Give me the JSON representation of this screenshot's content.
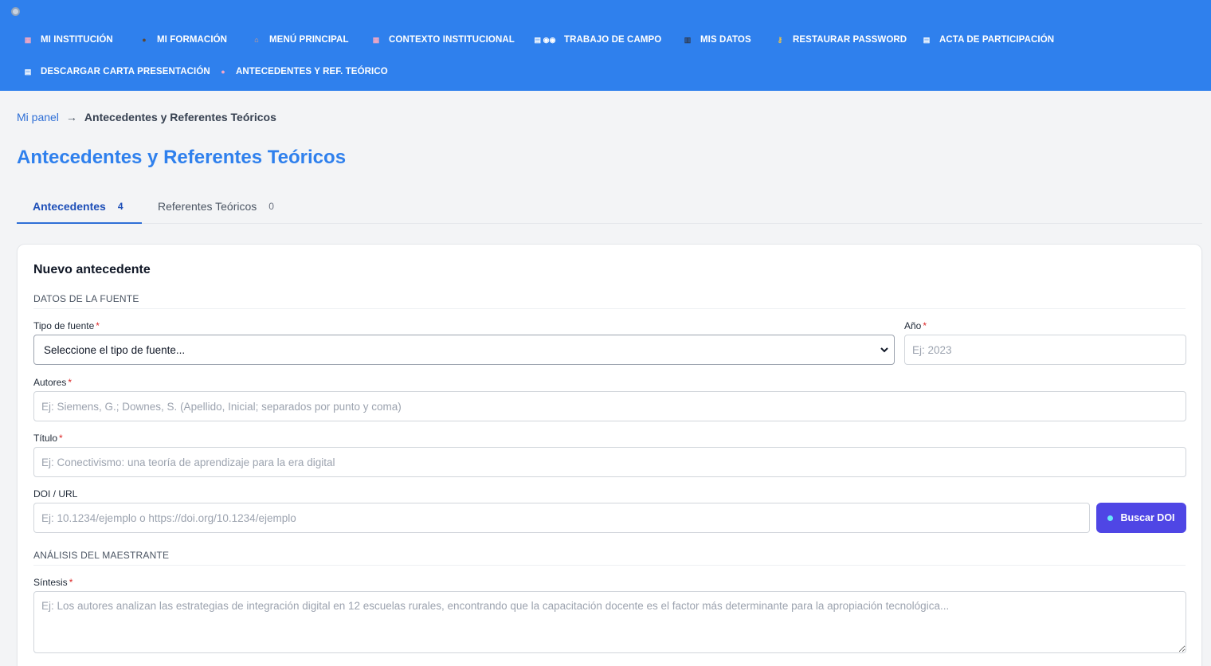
{
  "nav": {
    "row1": [
      {
        "label": "MI INSTITUCIÓN",
        "icon": "building-icon",
        "glyph": "▦",
        "color": "#f0a8c4"
      },
      {
        "label": "MI FORMACIÓN",
        "icon": "graduate-icon",
        "glyph": "●",
        "color": "#5b4636"
      },
      {
        "label": "MENÚ PRINCIPAL",
        "icon": "house-icon",
        "glyph": "⌂",
        "color": "#e8a07c"
      },
      {
        "label": "CONTEXTO INSTITUCIONAL",
        "icon": "building-icon",
        "glyph": "▦",
        "color": "#f0a8c4"
      },
      {
        "label": "TRABAJO DE CAMPO",
        "icon": "clipboard-eyes-icon",
        "glyph": "▤ ◉◉",
        "color": "#ffffff"
      },
      {
        "label": "MIS DATOS",
        "icon": "database-icon",
        "glyph": "▥",
        "color": "#2f3b52"
      },
      {
        "label": "RESTAURAR PASSWORD",
        "icon": "key-icon",
        "glyph": "⚷",
        "color": "#f5c542"
      },
      {
        "label": "ACTA DE PARTICIPACIÓN",
        "icon": "document-icon",
        "glyph": "▤",
        "color": "#ffffff"
      }
    ],
    "row2": [
      {
        "label": "DESCARGAR CARTA PRESENTACIÓN",
        "icon": "receipt-icon",
        "glyph": "▤",
        "color": "#ffffff"
      },
      {
        "label": "ANTECEDENTES Y REF. TEÓRICO",
        "icon": "brain-icon",
        "glyph": "●",
        "color": "#f3a6c8"
      }
    ]
  },
  "breadcrumb": {
    "link": "Mi panel",
    "arrow": "→",
    "current": "Antecedentes y Referentes Teóricos"
  },
  "page_title": "Antecedentes y Referentes Teóricos",
  "tabs": [
    {
      "label": "Antecedentes",
      "count": "4",
      "active": true
    },
    {
      "label": "Referentes Teóricos",
      "count": "0",
      "active": false
    }
  ],
  "form": {
    "title": "Nuevo antecedente",
    "section_source": "DATOS DE LA FUENTE",
    "tipo_label": "Tipo de fuente",
    "tipo_value": "Seleccione el tipo de fuente...",
    "anio_label": "Año",
    "anio_placeholder": "Ej: 2023",
    "autores_label": "Autores",
    "autores_placeholder": "Ej: Siemens, G.; Downes, S. (Apellido, Inicial; separados por punto y coma)",
    "titulo_label": "Título",
    "titulo_placeholder": "Ej: Conectivismo: una teoría de aprendizaje para la era digital",
    "doi_label": "DOI / URL",
    "doi_placeholder": "Ej: 10.1234/ejemplo o https://doi.org/10.1234/ejemplo",
    "doi_button": "Buscar DOI",
    "section_analysis": "ANÁLISIS DEL MAESTRANTE",
    "sintesis_label": "Síntesis",
    "sintesis_placeholder": "Ej: Los autores analizan las estrategias de integración digital en 12 escuelas rurales, encontrando que la capacitación docente es el factor más determinante para la apropiación tecnológica...",
    "required_mark": "*"
  },
  "colors": {
    "nav_bg": "#2f80ed",
    "title_blue": "#2f80ed",
    "button_indigo": "#4f46e5",
    "required_red": "#dc2626"
  }
}
